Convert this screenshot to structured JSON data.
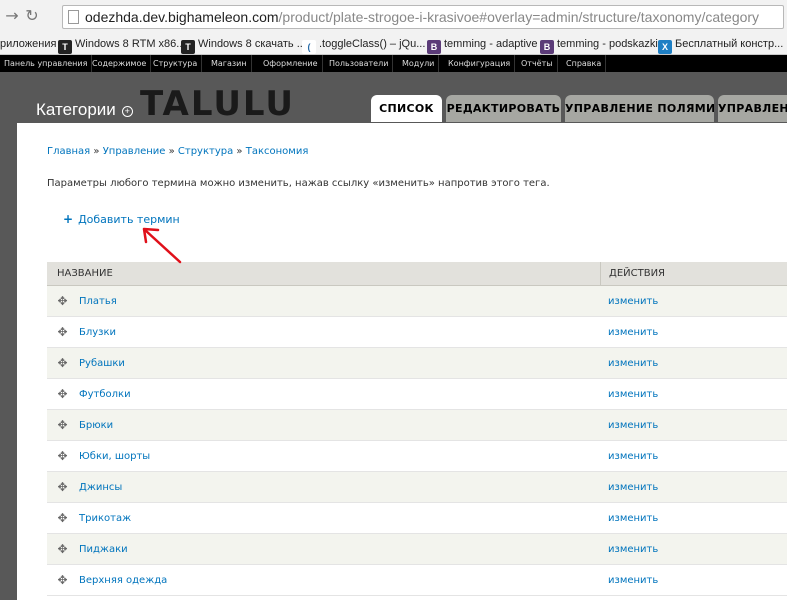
{
  "browser": {
    "url_host": "odezhda.dev.bighameleon.com",
    "url_path": "/product/plate-strogoe-i-krasivoe#overlay=admin/structure/taxonomy/category",
    "bookmarks": [
      {
        "label": "риложения",
        "icon": ""
      },
      {
        "label": "Windows 8 RTM x86...",
        "icon": "T"
      },
      {
        "label": "Windows 8 скачать ...",
        "icon": "T"
      },
      {
        "label": ".toggleClass() – jQu...",
        "icon": "("
      },
      {
        "label": "temming - adaptive",
        "icon": "B"
      },
      {
        "label": "temming - podskazki",
        "icon": "B"
      },
      {
        "label": "Бесплатный констр...",
        "icon": "X"
      }
    ]
  },
  "toolbar": {
    "items": [
      "Панель управления",
      "Содержимое",
      "Структура",
      "Магазин",
      "Оформление",
      "Пользователи",
      "Модули",
      "Конфигурация",
      "Отчёты",
      "Справка"
    ]
  },
  "overlay": {
    "watermark": "TALULU",
    "title": "Категории",
    "tabs": [
      "СПИСОК",
      "РЕДАКТИРОВАТЬ",
      "УПРАВЛЕНИЕ ПОЛЯМИ",
      "УПРАВЛЕН"
    ]
  },
  "breadcrumb": [
    "Главная",
    "Управление",
    "Структура",
    "Таксономия"
  ],
  "help_text": "Параметры любого термина можно изменить, нажав ссылку «изменить» напротив этого тега.",
  "add_term": "Добавить термин",
  "table": {
    "headers": [
      "НАЗВАНИЕ",
      "ДЕЙСТВИЯ"
    ],
    "edit_label": "изменить",
    "rows": [
      "Платья",
      "Блузки",
      "Рубашки",
      "Футболки",
      "Брюки",
      "Юбки, шорты",
      "Джинсы",
      "Трикотаж",
      "Пиджаки",
      "Верхняя одежда"
    ]
  }
}
